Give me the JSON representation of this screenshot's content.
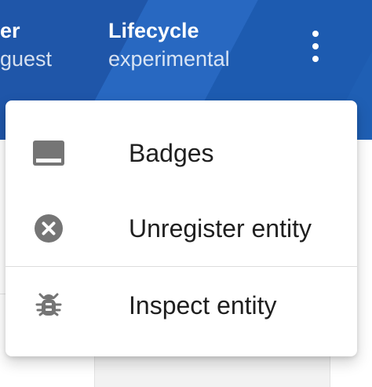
{
  "header": {
    "owner": {
      "label": "er",
      "value": "guest"
    },
    "lifecycle": {
      "label": "Lifecycle",
      "value": "experimental"
    },
    "more_menu_icon": "more-vert-icon"
  },
  "menu": {
    "items": [
      {
        "label": "Badges",
        "icon": "badge-icon"
      },
      {
        "label": "Unregister entity",
        "icon": "cancel-circle-icon"
      },
      {
        "label": "Inspect entity",
        "icon": "bug-icon"
      }
    ]
  },
  "colors": {
    "header_primary": "#1f5fb4",
    "header_secondary": "#2868c1",
    "menu_background": "#ffffff",
    "icon_gray": "#757575",
    "menu_text": "#1f1f1f"
  }
}
